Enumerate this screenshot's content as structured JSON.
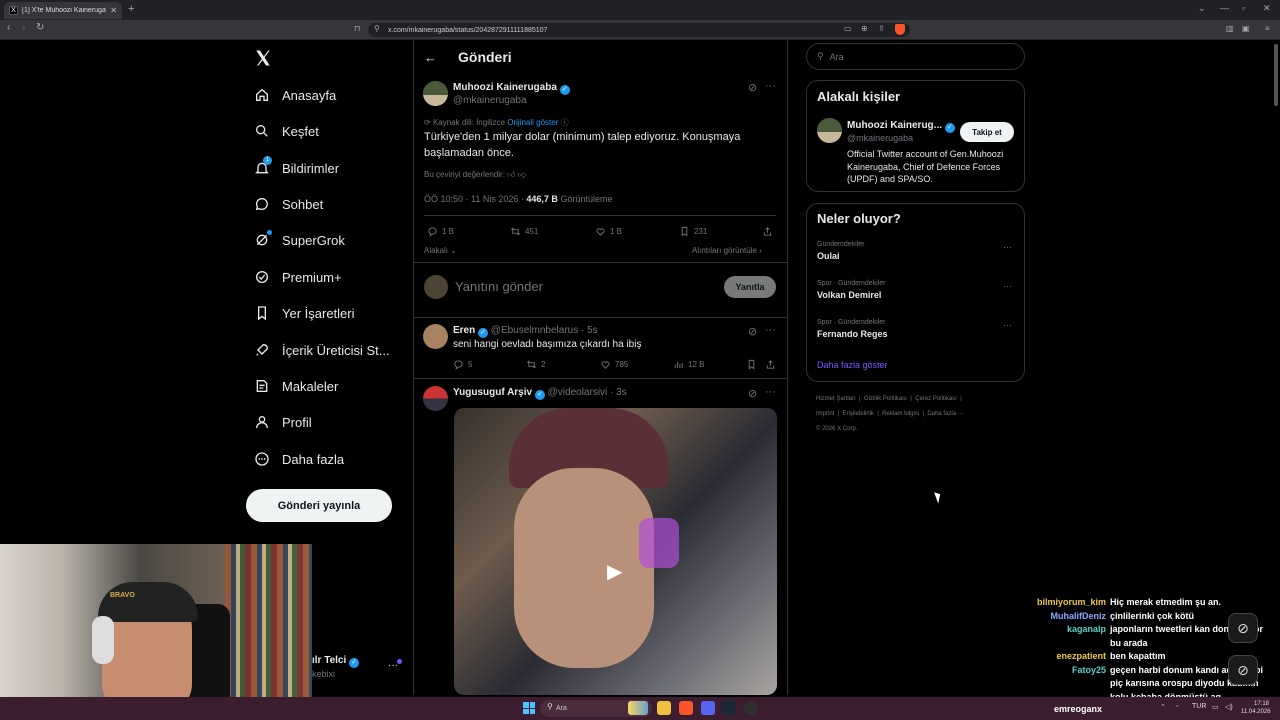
{
  "browser": {
    "tab_title": "[1] X'te Muhoozi Kainerugaba: \"T",
    "tab_favicon": "X",
    "url": "x.com/mkainerugaba/status/2042872911111885107"
  },
  "nav": {
    "items": [
      {
        "label": "Anasayfa",
        "icon": "home-icon"
      },
      {
        "label": "Keşfet",
        "icon": "search-icon"
      },
      {
        "label": "Bildirimler",
        "icon": "bell-icon",
        "badge": "1"
      },
      {
        "label": "Sohbet",
        "icon": "chat-icon"
      },
      {
        "label": "SuperGrok",
        "icon": "grok-icon"
      },
      {
        "label": "Premium+",
        "icon": "premium-icon"
      },
      {
        "label": "Yer İşaretleri",
        "icon": "bookmark-icon"
      },
      {
        "label": "İçerik Üreticisi St...",
        "icon": "rocket-icon"
      },
      {
        "label": "Makaleler",
        "icon": "article-icon"
      },
      {
        "label": "Profil",
        "icon": "person-icon"
      },
      {
        "label": "Daha fazla",
        "icon": "more-icon"
      }
    ],
    "post_button": "Gönderi yayınla",
    "account_name": "ılr Telci",
    "account_handle": "kebixi"
  },
  "webcam": {
    "hat_text": "BRAVO"
  },
  "main": {
    "header_title": "Gönderi",
    "tweet": {
      "author": "Muhoozi Kainerugaba",
      "handle": "@mkainerugaba",
      "source_lang": "Kaynak dili: İngilizce",
      "show_original": "Orijinali göster",
      "text": "Türkiye'den 1 milyar dolar (minimum) talep ediyoruz. Konuşmaya başlamadan önce.",
      "rate_translation": "Bu çeviriyi değerlendir:",
      "time": "ÖÖ 10:50 · 11 Nis 2026 ·",
      "views": "446,7 B",
      "views_label": "Görüntüleme",
      "replies": "1 B",
      "reposts": "451",
      "likes": "1 B",
      "bookmarks": "231"
    },
    "related_label": "Alakalı",
    "quotes_label": "Alıntıları görüntüle",
    "reply_placeholder": "Yanıtını gönder",
    "reply_button": "Yanıtla",
    "replies": [
      {
        "author": "Eren",
        "handle": "@Ebuselmnbelarus",
        "time": "· 5s",
        "text": "seni hangi oevladı başımıza çıkardı ha ibiş",
        "replies": "5",
        "reposts": "2",
        "likes": "785",
        "views": "12 B"
      },
      {
        "author": "Yugusuguf Arşiv",
        "handle": "@videolarsivi",
        "time": "· 3s"
      }
    ]
  },
  "right": {
    "search_placeholder": "Ara",
    "relevant_title": "Alakalı kişiler",
    "person": {
      "name": "Muhoozi Kainerug...",
      "handle": "@mkainerugaba",
      "follow": "Takip et",
      "bio": "Official Twitter account of Gen.Muhoozi Kainerugaba, Chief of Defence Forces (UPDF) and SPA/SO."
    },
    "trends_title": "Neler oluyor?",
    "trends": [
      {
        "category": "Gündemdekiler",
        "name": "Oulai"
      },
      {
        "category": "Spor · Gündemdekiler",
        "name": "Volkan Demirel"
      },
      {
        "category": "Spor · Gündemdekiler",
        "name": "Fernando Reges"
      }
    ],
    "show_more": "Daha fazla göster",
    "footer": {
      "line1": [
        "Hizmet Şartları",
        "Gizlilik Politikası",
        "Çerez Politikası"
      ],
      "line2": [
        "Imprint",
        "Erişilebilirlik",
        "Reklam bilgisi",
        "Daha fazla ···"
      ],
      "copyright": "© 2026 X Corp."
    }
  },
  "chat": {
    "messages": [
      {
        "user": "bilmiyorum_kim",
        "color": "#f0c94a",
        "text": "Hiç merak etmedim şu an."
      },
      {
        "user": "MuhalifDeniz",
        "color": "#8aa8ff",
        "text": "çinlilerinki çok kötü"
      },
      {
        "user": "kaganalp",
        "color": "#5ad1c8",
        "text": "japonların tweetleri kan donduruyor bu arada"
      },
      {
        "user": "enezpatient",
        "color": "#f0c94a",
        "text": "ben kapattım"
      },
      {
        "user": "Fatoy25",
        "color": "#5ad1c8",
        "text": "geçen harbi donum kandı aq sinli bi piç karısına orospu diyodu kadının kolu kebaba dönmüştü aq"
      }
    ],
    "channel": "emreoganx"
  },
  "taskbar": {
    "search": "Ara",
    "lang": "TUR",
    "time": "17:18",
    "date": "11.04.2026"
  },
  "colors": {
    "accent": "#1d9bf0",
    "background": "#000000",
    "border": "#2f3336",
    "muted": "#71767b",
    "purple_link": "#7856ff"
  }
}
